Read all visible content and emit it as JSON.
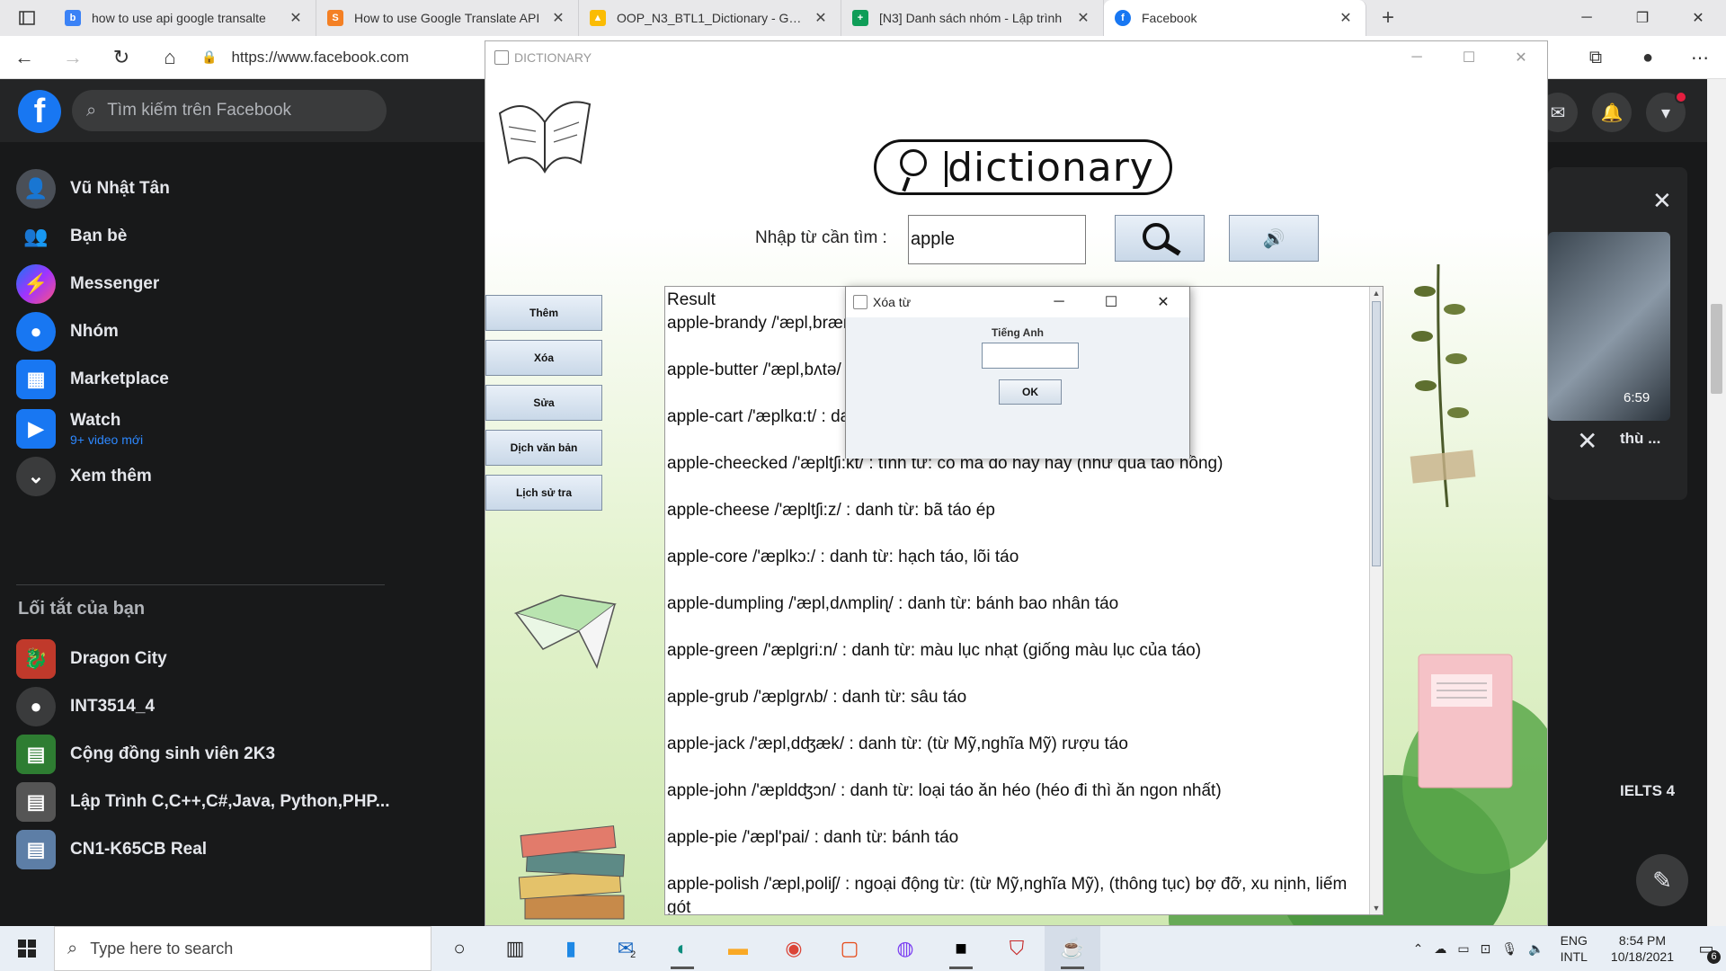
{
  "browser": {
    "tabs": [
      {
        "title": "how to use api google transalte",
        "favicon_color": "#3b82f6",
        "favicon_glyph": "b"
      },
      {
        "title": "How to use Google Translate API",
        "favicon_color": "#f48024",
        "favicon_glyph": "S"
      },
      {
        "title": "OOP_N3_BTL1_Dictionary - Goog",
        "favicon_color": "#fbbc04",
        "favicon_glyph": "▲"
      },
      {
        "title": "[N3] Danh sách nhóm - Lập trình",
        "favicon_color": "#0f9d58",
        "favicon_glyph": "+"
      },
      {
        "title": "Facebook",
        "favicon_color": "#1877f2",
        "favicon_glyph": "f"
      }
    ],
    "url": "https://www.facebook.com"
  },
  "facebook": {
    "search_placeholder": "Tìm kiếm trên Facebook",
    "sidebar": [
      {
        "label": "Vũ Nhật Tân",
        "icon": "profile-avatar",
        "color": "#4a4f57"
      },
      {
        "label": "Bạn bè",
        "icon": "friends-icon",
        "color": "#1877f2"
      },
      {
        "label": "Messenger",
        "icon": "messenger-icon",
        "color": "#a033ff"
      },
      {
        "label": "Nhóm",
        "icon": "groups-icon",
        "color": "#1877f2"
      },
      {
        "label": "Marketplace",
        "icon": "marketplace-icon",
        "color": "#1877f2"
      },
      {
        "label": "Watch",
        "icon": "watch-icon",
        "color": "#1877f2",
        "sub": "9+ video mới"
      },
      {
        "label": "Xem thêm",
        "icon": "chevron-down-icon",
        "color": "#3a3b3c"
      }
    ],
    "shortcuts_heading": "Lối tắt của bạn",
    "shortcuts": [
      {
        "label": "Dragon City",
        "icon": "dragon-city-icon",
        "color": "#c0392b"
      },
      {
        "label": "INT3514_4",
        "icon": "group-icon",
        "color": "#3a3b3c"
      },
      {
        "label": "Cộng đồng sinh viên 2K3",
        "icon": "group-thumb-icon",
        "color": "#2e7d32"
      },
      {
        "label": "Lập Trình C,C++,C#,Java, Python,PHP...",
        "icon": "group-thumb-icon",
        "color": "#555555"
      },
      {
        "label": "CN1-K65CB Real",
        "icon": "group-thumb-icon",
        "color": "#5d7ea6"
      }
    ],
    "video_time": "6:59",
    "video_title": "thù ...",
    "ielts_label": "IELTS 4"
  },
  "dictionary_app": {
    "window_title": "DICTIONARY",
    "logo_text": "dictionary",
    "search_label": "Nhập từ cần tìm :",
    "search_value": "apple",
    "side_buttons": [
      "Thêm",
      "Xóa",
      "Sửa",
      "Dịch văn bản",
      "Lịch sử tra"
    ],
    "result_title": "Result",
    "results": [
      "apple-brandy /'æpl,brændi/  : danh từ: rượu táo",
      "apple-butter /'æpl,bʌtə/  : danh từ: mứt táo",
      "apple-cart /'æplkɑ:t/  : danh từ: xe táo",
      "apple-cheecked /'æpltʃi:kt/  : tính từ: có má đỏ hây hây (như quả táo hồng)",
      "apple-cheese /'æpltʃi:z/  : danh từ: bã táo ép",
      "apple-core /'æplkɔ:/  : danh từ: hạch táo, lõi táo",
      "apple-dumpling /'æpl,dʌmpliɳ/  : danh từ: bánh bao nhân táo",
      "apple-green /'æplgri:n/  : danh từ: màu lục nhạt (giống màu lục của táo)",
      "apple-grub /'æplgrʌb/  : danh từ: sâu táo",
      "apple-jack /'æpl,dʤæk/  : danh từ: (từ Mỹ,nghĩa Mỹ) rượu táo",
      "apple-john /'æpldʤɔn/  : danh từ: loại táo ăn héo (héo đi thì ăn ngon nhất)",
      "apple-pie /'æpl'pai/  : danh từ: bánh táo",
      "apple-polish /'æpl,poliʃ/  : ngoại động từ: (từ Mỹ,nghĩa Mỹ),  (thông tục) bợ đỡ, xu nịnh, liếm gót"
    ],
    "dialog": {
      "title": "Xóa từ",
      "label": "Tiếng Anh",
      "input_value": "",
      "ok_label": "OK"
    }
  },
  "taskbar": {
    "search_placeholder": "Type here to search",
    "mail_badge": "2",
    "lang_top": "ENG",
    "lang_bottom": "INTL",
    "time": "8:54 PM",
    "date": "10/18/2021",
    "notification_count": "6"
  }
}
